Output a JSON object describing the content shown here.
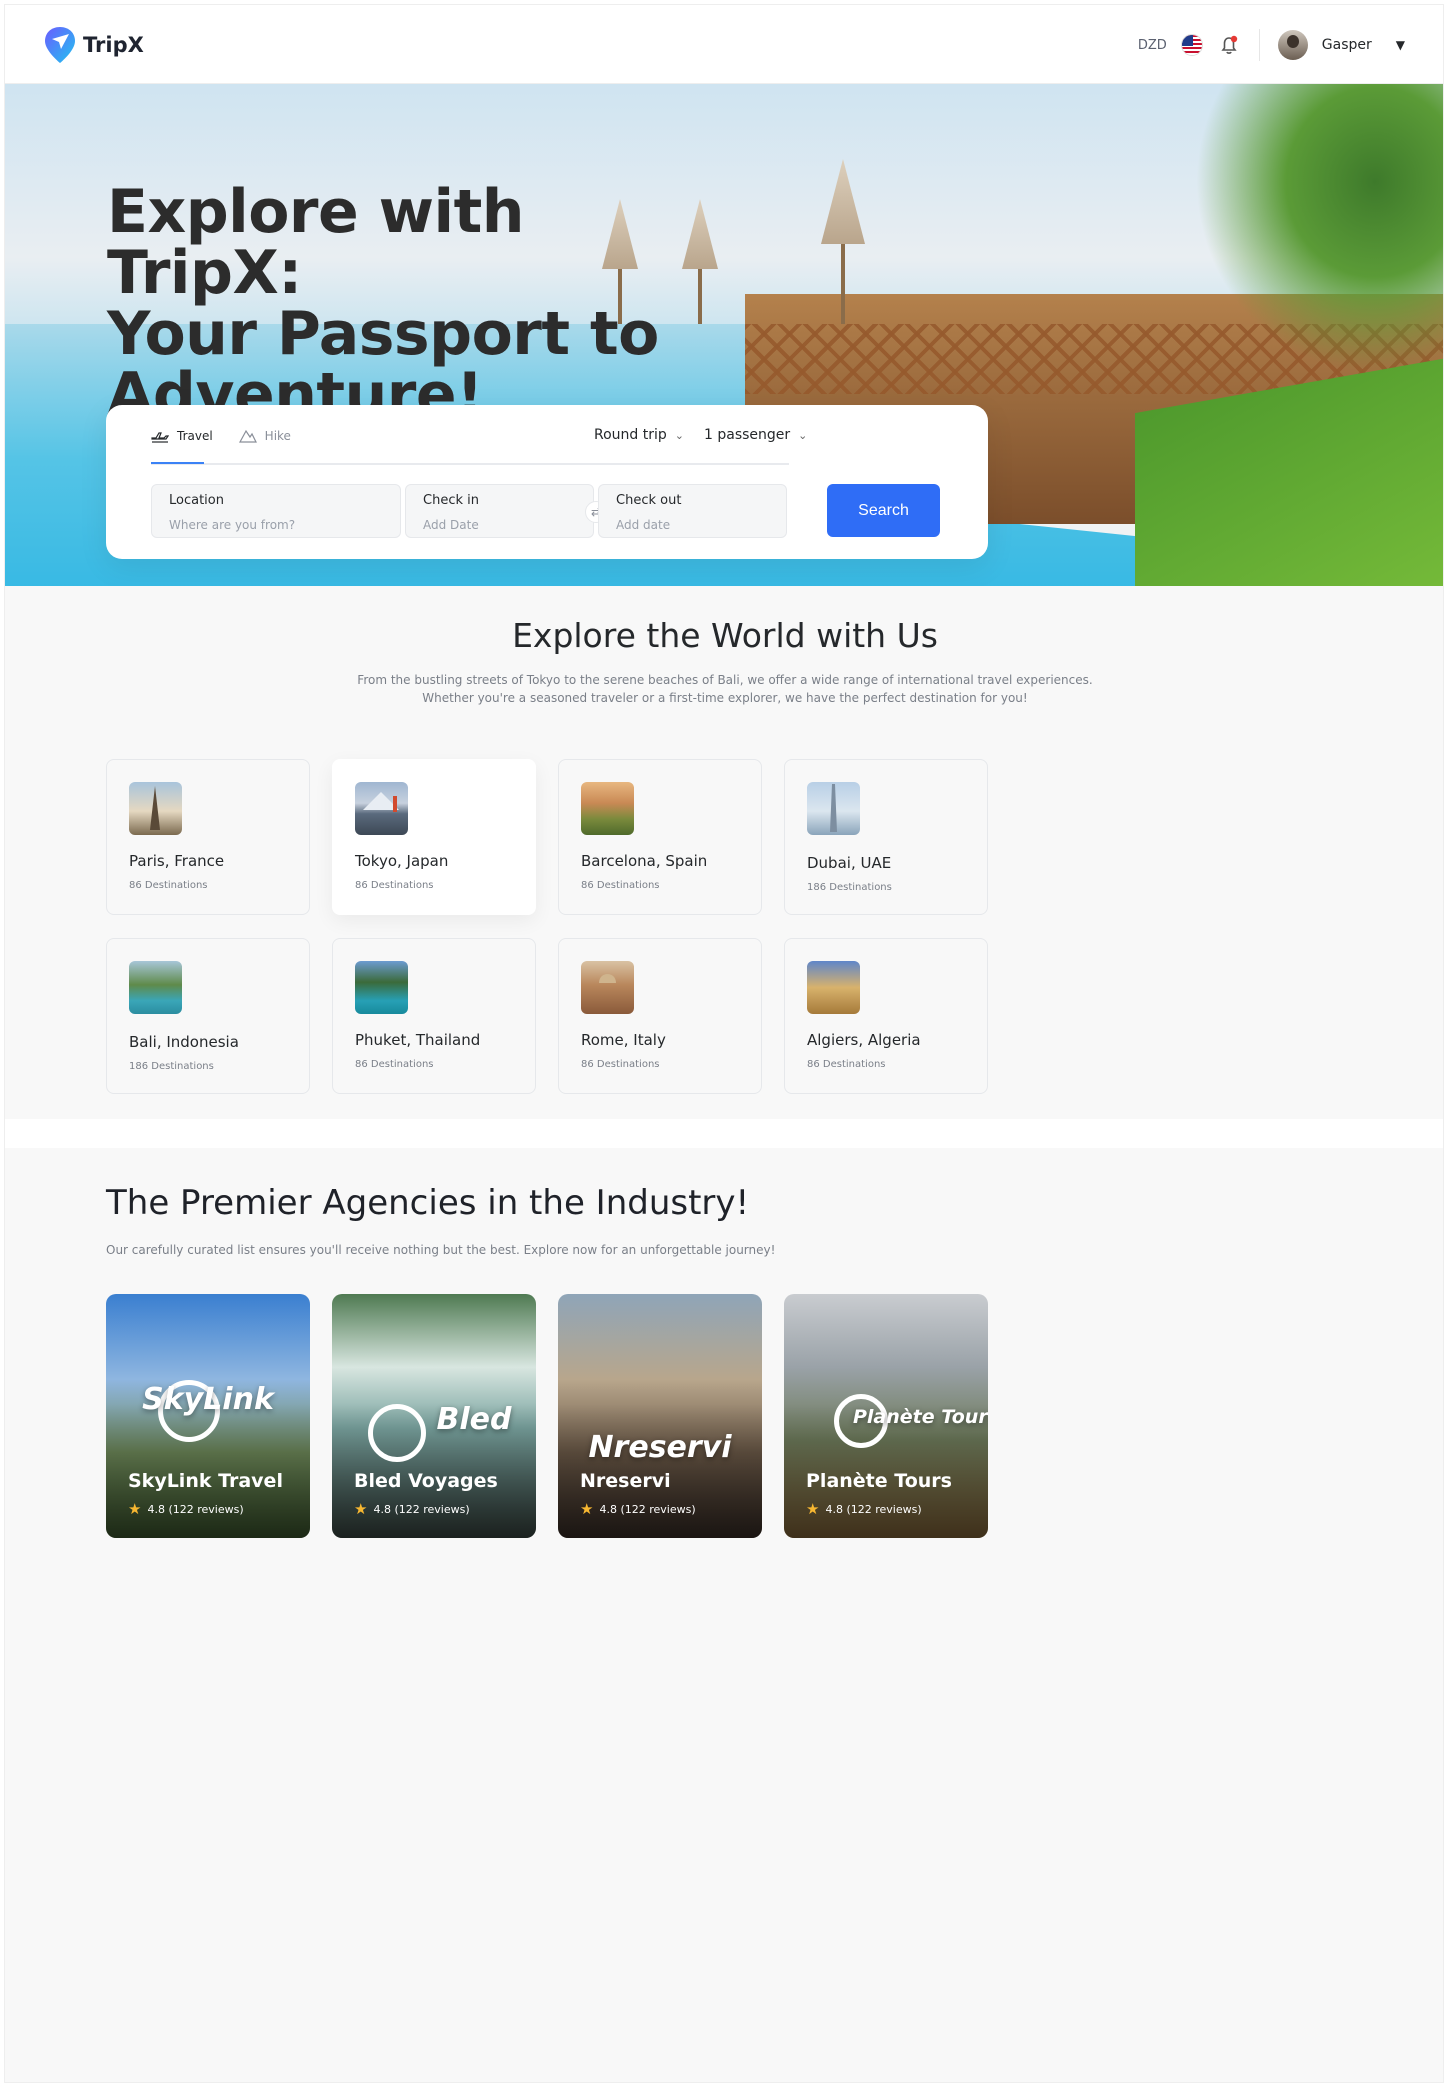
{
  "header": {
    "brand": "TripX",
    "currency": "DZD",
    "user_name": "Gasper"
  },
  "hero": {
    "title": "Explore with TripX:\nYour Passport to\nAdventure!"
  },
  "search": {
    "tabs": [
      {
        "label": "Travel",
        "active": true
      },
      {
        "label": "Hike",
        "active": false
      }
    ],
    "trip_type": "Round trip",
    "passengers": "1 passenger",
    "location_label": "Location",
    "location_placeholder": "Where are you from?",
    "checkin_label": "Check in",
    "checkin_placeholder": "Add Date",
    "checkout_label": "Check out",
    "checkout_placeholder": "Add date",
    "button": "Search",
    "button_color": "#2f6df6"
  },
  "explore": {
    "title": "Explore the World with Us",
    "subtitle_line1": "From the bustling streets of Tokyo to the serene beaches of Bali, we offer a wide range of international travel experiences.",
    "subtitle_line2": "Whether you're a seasoned traveler or a first-time explorer, we have the perfect destination for you!",
    "destinations": [
      {
        "name": "Paris, France",
        "count": "86 Destinations"
      },
      {
        "name": "Tokyo, Japan",
        "count": "86 Destinations"
      },
      {
        "name": "Barcelona, Spain",
        "count": "86 Destinations"
      },
      {
        "name": "Dubai, UAE",
        "count": "186 Destinations"
      },
      {
        "name": "Bali, Indonesia",
        "count": "186 Destinations"
      },
      {
        "name": "Phuket, Thailand",
        "count": "86 Destinations"
      },
      {
        "name": "Rome, Italy",
        "count": "86 Destinations"
      },
      {
        "name": "Algiers, Algeria",
        "count": "86 Destinations"
      }
    ]
  },
  "agencies": {
    "title": "The Premier Agencies in the Industry!",
    "subtitle": "Our carefully curated list ensures you'll receive nothing but the best. Explore now for an unforgettable journey!",
    "items": [
      {
        "name": "SkyLink Travel",
        "logo": "SkyLink",
        "rating": "4.8 (122 reviews)"
      },
      {
        "name": "Bled Voyages",
        "logo": "Bled",
        "rating": "4.8 (122 reviews)"
      },
      {
        "name": "Nreservi",
        "logo": "Nreservi",
        "rating": "4.8 (122 reviews)"
      },
      {
        "name": "Planète Tours",
        "logo": "Planète Tours",
        "rating": "4.8 (122 reviews)"
      }
    ]
  }
}
